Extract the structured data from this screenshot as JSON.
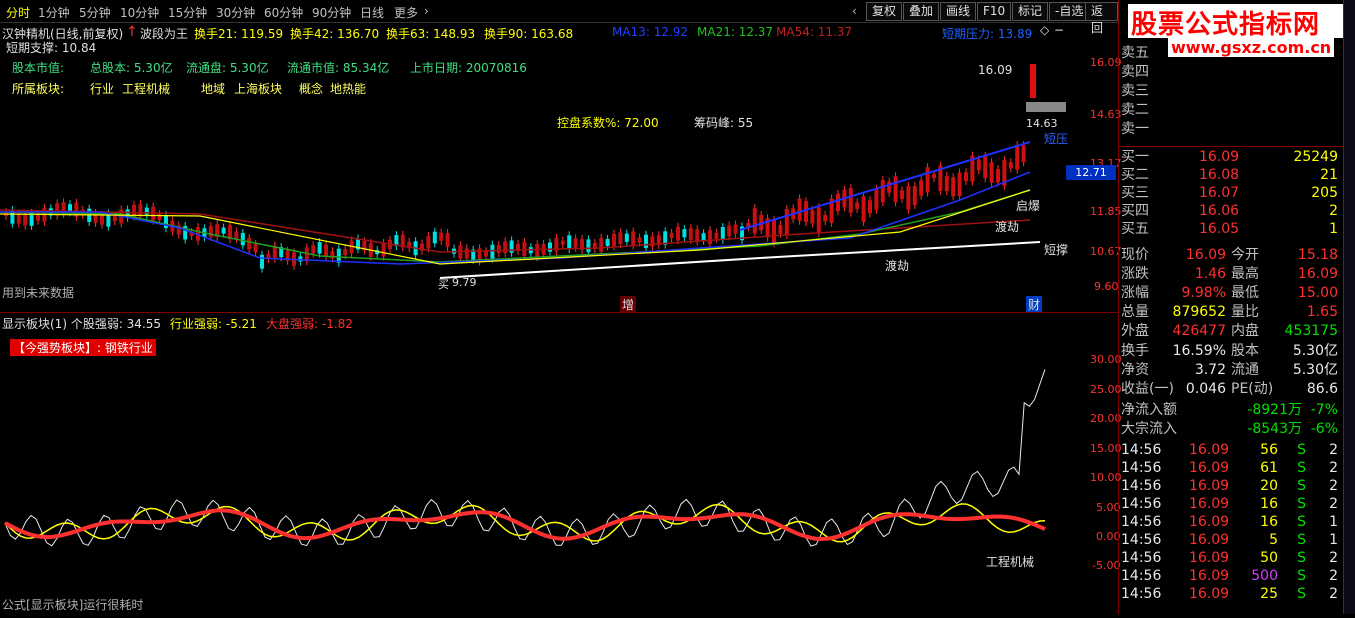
{
  "toolbar": {
    "tabs": [
      "分时",
      "1分钟",
      "5分钟",
      "10分钟",
      "15分钟",
      "30分钟",
      "60分钟",
      "90分钟",
      "日线",
      "更多"
    ],
    "right_buttons": [
      "复权",
      "叠加",
      "画线",
      "F10",
      "标记",
      "-自选",
      "返回"
    ]
  },
  "header": {
    "stock_name": "汉钟精机(日线,前复权)",
    "boduan": "波段为王",
    "hs21": "换手21: 119.59",
    "hs42": "换手42: 136.70",
    "hs63": "换手63: 148.93",
    "hs90": "换手90: 163.68",
    "ma13": "MA13: 12.92",
    "ma21": "MA21: 12.37",
    "ma54": "MA54: 11.37",
    "short_pressure": "短期压力: 13.89",
    "short_support": "短期支撑: 10.84"
  },
  "info": {
    "row1": [
      "股本市值:",
      "总股本: 5.30亿",
      "流通盘: 5.30亿",
      "流通市值: 85.34亿",
      "上市日期: 20070816"
    ],
    "row2": [
      "所属板块:",
      "行业",
      "工程机械",
      "地域",
      "上海板块",
      "概念",
      "地热能"
    ],
    "kongpan": "控盘系数%: 72.00",
    "chouma": "筹码峰: 55"
  },
  "annotations": {
    "high": "16.09",
    "low_mark": "9.79",
    "low_prefix": "买",
    "qibao": "启爆",
    "dujie1": "渡劫",
    "dujie2": "渡劫",
    "duanya": "短压",
    "duancheng": "短撑",
    "future_data": "用到未来数据",
    "zeng": "增",
    "cai": "财",
    "price_tag": "12.71",
    "low_tag": "14.63"
  },
  "price_axis": [
    "16.09",
    "14.63",
    "13.17",
    "11.85",
    "10.67",
    "9.60"
  ],
  "indicator": {
    "title": "显示板块(1) 个股强弱: 34.55",
    "industry": "行业强弱: -5.21",
    "market": "大盘强弱: -1.82",
    "strong_sector": "【今强势板块】: 钢铁行业",
    "sector_label": "工程机械",
    "bottom_note": "公式[显示板块]运行很耗时",
    "axis": [
      "30.00",
      "25.00",
      "20.00",
      "15.00",
      "10.00",
      "5.00",
      "0.00",
      "-5.00"
    ]
  },
  "logo": {
    "title": "股票公式指标网",
    "url": "www.gsxz.com.cn"
  },
  "orderbook": {
    "asks": [
      {
        "label": "卖五"
      },
      {
        "label": "卖四"
      },
      {
        "label": "卖三"
      },
      {
        "label": "卖二"
      },
      {
        "label": "卖一"
      }
    ],
    "bids": [
      {
        "label": "买一",
        "price": "16.09",
        "vol": "25249"
      },
      {
        "label": "买二",
        "price": "16.08",
        "vol": "21"
      },
      {
        "label": "买三",
        "price": "16.07",
        "vol": "205"
      },
      {
        "label": "买四",
        "price": "16.06",
        "vol": "2"
      },
      {
        "label": "买五",
        "price": "16.05",
        "vol": "1"
      }
    ]
  },
  "quote": [
    {
      "l1": "现价",
      "v1": "16.09",
      "l2": "今开",
      "v2": "15.18",
      "c1": "red",
      "c2": "red"
    },
    {
      "l1": "涨跌",
      "v1": "1.46",
      "l2": "最高",
      "v2": "16.09",
      "c1": "red",
      "c2": "red"
    },
    {
      "l1": "涨幅",
      "v1": "9.98%",
      "l2": "最低",
      "v2": "15.00",
      "c1": "red",
      "c2": "red"
    },
    {
      "l1": "总量",
      "v1": "879652",
      "l2": "量比",
      "v2": "1.65",
      "c1": "yel",
      "c2": "red"
    },
    {
      "l1": "外盘",
      "v1": "426477",
      "l2": "内盘",
      "v2": "453175",
      "c1": "red",
      "c2": "grn"
    }
  ],
  "fund": [
    {
      "l1": "换手",
      "v1": "16.59%",
      "l2": "股本",
      "v2": "5.30亿"
    },
    {
      "l1": "净资",
      "v1": "3.72",
      "l2": "流通",
      "v2": "5.30亿"
    },
    {
      "l1": "收益(一)",
      "v1": "0.046",
      "l2": "PE(动)",
      "v2": "86.6"
    }
  ],
  "flows": [
    {
      "l": "净流入额",
      "v": "-8921万",
      "p": "-7%"
    },
    {
      "l": "大宗流入",
      "v": "-8543万",
      "p": "-6%"
    }
  ],
  "ticks": [
    {
      "t": "14:56",
      "p": "16.09",
      "v": "56",
      "s": "S",
      "n": "2"
    },
    {
      "t": "14:56",
      "p": "16.09",
      "v": "61",
      "s": "S",
      "n": "2"
    },
    {
      "t": "14:56",
      "p": "16.09",
      "v": "20",
      "s": "S",
      "n": "2"
    },
    {
      "t": "14:56",
      "p": "16.09",
      "v": "16",
      "s": "S",
      "n": "2"
    },
    {
      "t": "14:56",
      "p": "16.09",
      "v": "16",
      "s": "S",
      "n": "1"
    },
    {
      "t": "14:56",
      "p": "16.09",
      "v": "5",
      "s": "S",
      "n": "1"
    },
    {
      "t": "14:56",
      "p": "16.09",
      "v": "50",
      "s": "S",
      "n": "2"
    },
    {
      "t": "14:56",
      "p": "16.09",
      "v": "500",
      "s": "S",
      "n": "2"
    },
    {
      "t": "14:56",
      "p": "16.09",
      "v": "25",
      "s": "S",
      "n": "2"
    }
  ],
  "colors": {
    "up": "#ff3030",
    "down": "#00e0e0",
    "ma_blue": "#2030ff",
    "ma_green": "#20a020",
    "ma_dark": "#a01010",
    "white": "#ffffff",
    "yellow": "#ffff00"
  }
}
